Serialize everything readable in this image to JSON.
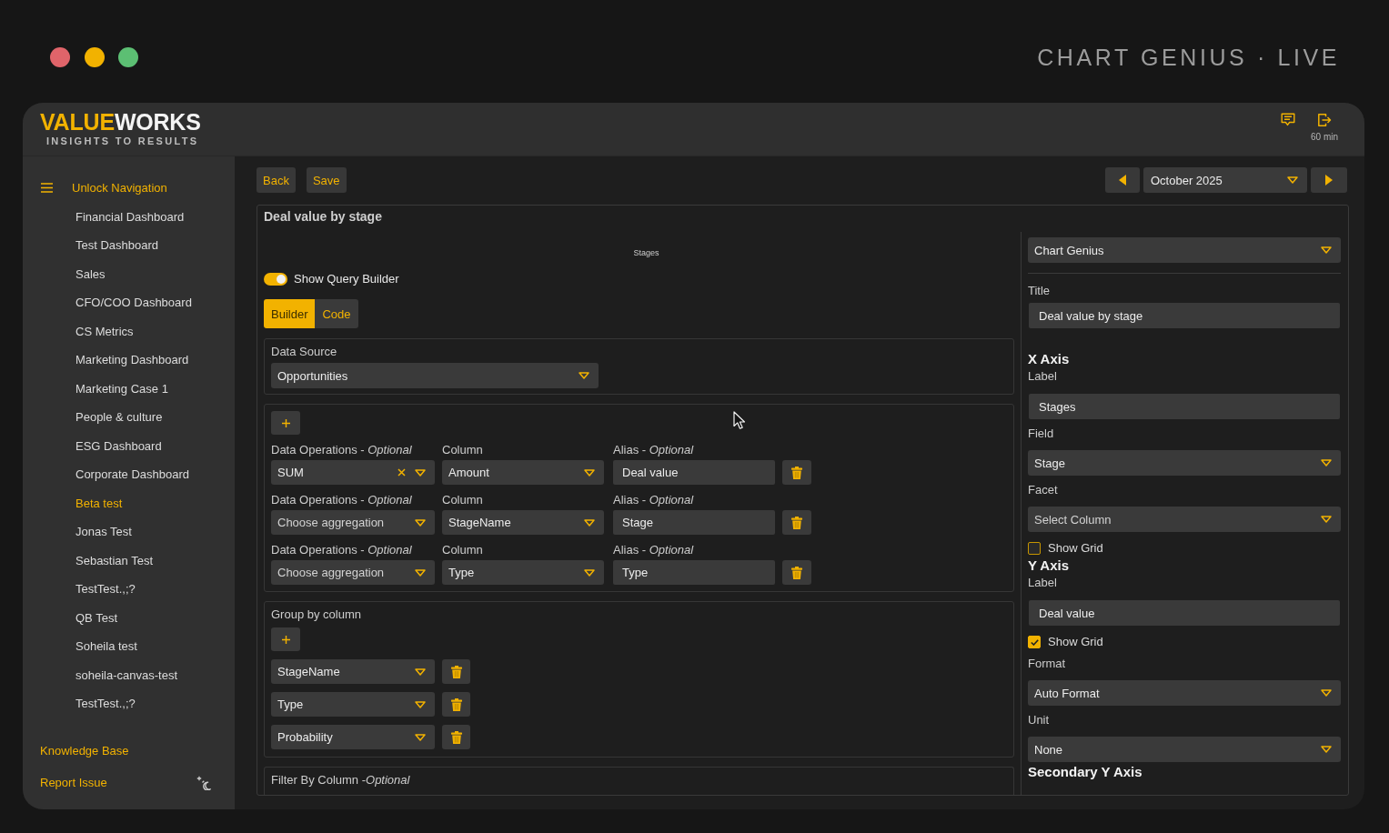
{
  "app_title": "CHART GENIUS · LIVE",
  "header": {
    "logo": {
      "primary": "VALUE",
      "secondary": "WORKS",
      "tagline": "INSIGHTS TO RESULTS"
    },
    "session_time": "60 min"
  },
  "sidebar": {
    "unlock_label": "Unlock Navigation",
    "items": [
      {
        "label": "Financial Dashboard",
        "selected": false
      },
      {
        "label": "Test Dashboard",
        "selected": false
      },
      {
        "label": "Sales",
        "selected": false
      },
      {
        "label": "CFO/COO Dashboard",
        "selected": false
      },
      {
        "label": "CS Metrics",
        "selected": false
      },
      {
        "label": "Marketing Dashboard",
        "selected": false
      },
      {
        "label": "Marketing Case 1",
        "selected": false
      },
      {
        "label": "People & culture",
        "selected": false
      },
      {
        "label": "ESG Dashboard",
        "selected": false
      },
      {
        "label": "Corporate Dashboard",
        "selected": false
      },
      {
        "label": "Beta test",
        "selected": true
      },
      {
        "label": "Jonas Test",
        "selected": false
      },
      {
        "label": "Sebastian Test",
        "selected": false
      },
      {
        "label": "TestTest.,;?",
        "selected": false
      },
      {
        "label": "QB Test",
        "selected": false
      },
      {
        "label": "Soheila test",
        "selected": false
      },
      {
        "label": "soheila-canvas-test",
        "selected": false
      },
      {
        "label": "TestTest.,;?",
        "selected": false
      }
    ],
    "footer_links": [
      "Knowledge Base",
      "Report Issue"
    ]
  },
  "toolbar": {
    "buttons": [
      "Back",
      "Save"
    ],
    "month_select": {
      "value": "October 2025"
    }
  },
  "chart_editor": {
    "title": "Deal value by stage",
    "preview": {
      "x_label": "Stages"
    },
    "query_builder_toggle": {
      "label": "Show Query Builder",
      "on": true
    },
    "tabs": [
      {
        "label": "Builder",
        "selected": true
      },
      {
        "label": "Code",
        "selected": false
      }
    ],
    "data_source": {
      "label": "Data Source",
      "value": "Opportunities"
    },
    "operations": [
      {
        "operation_label": "Data Operations - *Optional*",
        "operation": {
          "value": "SUM"
        },
        "column_label": "Column",
        "column": "Amount",
        "alias_label": "Alias - *Optional*",
        "alias": "Deal value"
      },
      {
        "operation_label": "Data Operations - *Optional*",
        "operation": {
          "placeholder": "Choose aggregation"
        },
        "column_label": "Column",
        "column": "StageName",
        "alias_label": "Alias - *Optional*",
        "alias": "Stage"
      },
      {
        "operation_label": "Data Operations - *Optional*",
        "operation": {
          "placeholder": "Choose aggregation"
        },
        "column_label": "Column",
        "column": "Type",
        "alias_label": "Alias - *Optional*",
        "alias": "Type"
      }
    ],
    "group_by": {
      "label": "Group by column",
      "columns": [
        "StageName",
        "Type",
        "Probability"
      ]
    },
    "filter": {
      "label": "Filter By Column -*Optional*"
    }
  },
  "settings": {
    "chart_type": {
      "value": "Chart Genius"
    },
    "title_field": {
      "label": "Title",
      "value": "Deal value by stage"
    },
    "sections": [
      {
        "heading": "X Axis",
        "items": [
          {
            "kind": "input",
            "label": "Label",
            "value": "Stages"
          },
          {
            "kind": "select",
            "label": "Field",
            "value": "Stage"
          },
          {
            "kind": "select",
            "label": "Facet",
            "placeholder": "Select Column"
          },
          {
            "kind": "checkbox",
            "label": "Show Grid",
            "checked": false
          }
        ]
      },
      {
        "heading": "Y Axis",
        "items": [
          {
            "kind": "input",
            "label": "Label",
            "value": "Deal value"
          },
          {
            "kind": "checkbox",
            "label": "Show Grid",
            "checked": true
          },
          {
            "kind": "select",
            "label": "Format",
            "value": "Auto Format"
          },
          {
            "kind": "select",
            "label": "Unit",
            "value": "None"
          }
        ]
      },
      {
        "heading": "Secondary Y Axis"
      }
    ]
  }
}
